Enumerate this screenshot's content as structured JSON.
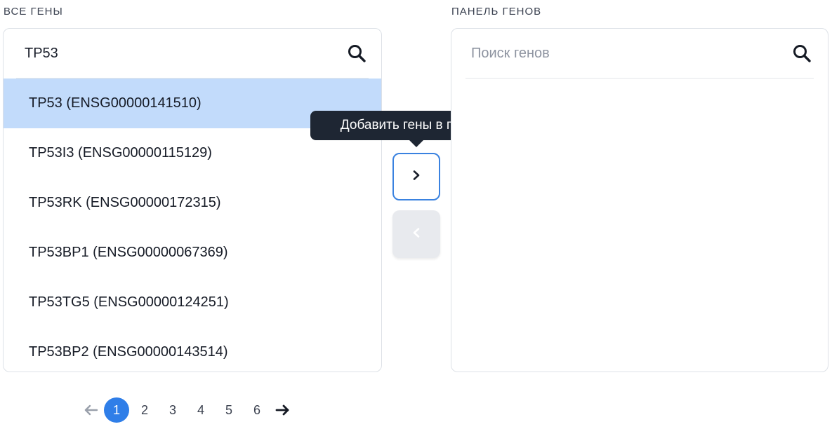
{
  "left_panel": {
    "label": "ВСЕ ГЕНЫ",
    "search_value": "TP53",
    "search_icon": "search-icon",
    "genes": [
      {
        "label": "TP53 (ENSG00000141510)",
        "selected": true
      },
      {
        "label": "TP53I3 (ENSG00000115129)",
        "selected": false
      },
      {
        "label": "TP53RK (ENSG00000172315)",
        "selected": false
      },
      {
        "label": "TP53BP1 (ENSG00000067369)",
        "selected": false
      },
      {
        "label": "TP53TG5 (ENSG00000124251)",
        "selected": false
      },
      {
        "label": "TP53BP2 (ENSG00000143514)",
        "selected": false
      }
    ]
  },
  "right_panel": {
    "label": "ПАНЕЛЬ ГЕНОВ",
    "search_placeholder": "Поиск генов",
    "search_icon": "search-icon"
  },
  "controls": {
    "add_icon": "chevron-right-icon",
    "remove_icon": "chevron-left-icon",
    "tooltip": "Добавить гены в панель"
  },
  "pagination": {
    "prev_icon": "arrow-left-icon",
    "next_icon": "arrow-right-icon",
    "pages": [
      "1",
      "2",
      "3",
      "4",
      "5",
      "6"
    ],
    "current": "1"
  },
  "colors": {
    "selected_row": "#c2dbfb",
    "accent": "#2f7ee8",
    "tooltip_bg": "#1e2633",
    "disabled_button": "#e8eaee"
  }
}
